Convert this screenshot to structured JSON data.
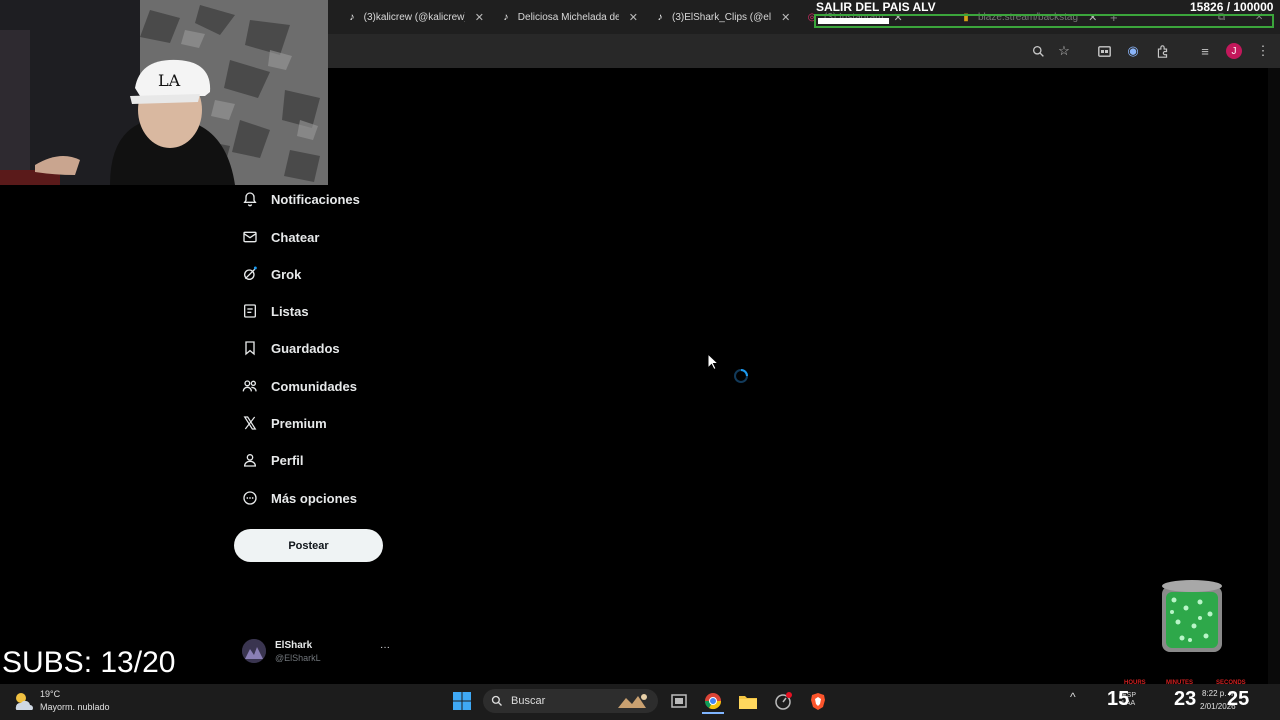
{
  "browser": {
    "tabs": [
      {
        "title": "(3)kalicrew (@kalicrew)",
        "icon": "tiktok-icon"
      },
      {
        "title": "Deliciosa Michelada de",
        "icon": "tiktok-icon"
      },
      {
        "title": "(3)ElShark_Clips (@el",
        "icon": "tiktok-icon"
      },
      {
        "title": "(3) Instagram",
        "icon": "instagram-icon"
      },
      {
        "title": "blaze.stream/backstag",
        "icon": "blaze-icon"
      }
    ],
    "new_tab_symbol": "+",
    "avatar_initial": "J"
  },
  "overlay": {
    "goal_title": "SALIR DEL PAIS ALV",
    "goal_count": "15826 / 100000",
    "goal_progress": 0.158,
    "subs_label": "SUBS: 13/20"
  },
  "sidebar": {
    "items": [
      {
        "label": "Notificaciones",
        "icon": "bell-icon"
      },
      {
        "label": "Chatear",
        "icon": "mail-icon"
      },
      {
        "label": "Grok",
        "icon": "grok-icon"
      },
      {
        "label": "Listas",
        "icon": "list-icon"
      },
      {
        "label": "Guardados",
        "icon": "bookmark-icon"
      },
      {
        "label": "Comunidades",
        "icon": "people-icon"
      },
      {
        "label": "Premium",
        "icon": "x-logo-icon"
      },
      {
        "label": "Perfil",
        "icon": "person-icon"
      },
      {
        "label": "Más opciones",
        "icon": "more-circle-icon"
      }
    ],
    "post_label": "Postear",
    "profile": {
      "name": "ElShark",
      "handle": "@ElSharkL",
      "more": "···"
    }
  },
  "taskbar": {
    "weather_temp": "19°C",
    "weather_desc": "Mayorm. nublado",
    "search_placeholder": "Buscar",
    "language": "ESP\nLAA",
    "time": "8:22 p. m.",
    "date": "2/01/2026"
  },
  "timer": {
    "hours": "15",
    "minutes": "23",
    "seconds": "25",
    "hours_label": "HOURS",
    "minutes_label": "MINUTES",
    "seconds_label": "SECONDS"
  },
  "colors": {
    "accent": "#1d9bf0",
    "goal_border": "#3ba53b",
    "avatar": "#c2185b"
  }
}
